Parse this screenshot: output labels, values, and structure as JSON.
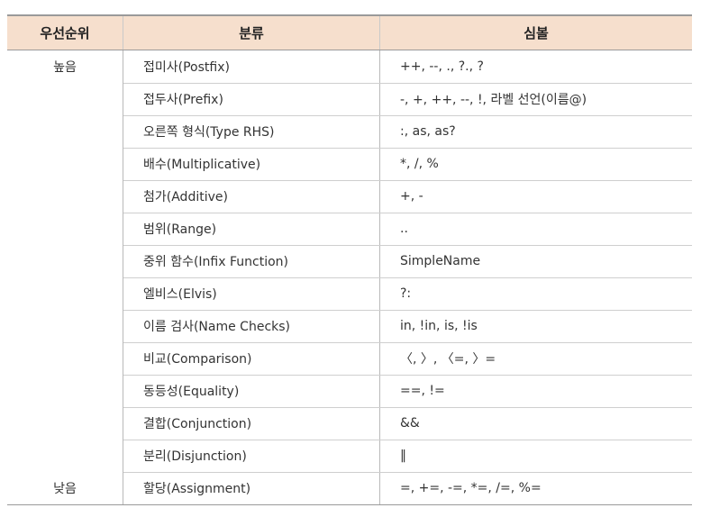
{
  "headers": {
    "priority": "우선순위",
    "category": "분류",
    "symbol": "심볼"
  },
  "rows": [
    {
      "priority": "높음",
      "category": "접미사(Postfix)",
      "symbol": "++, --, ., ?., ?"
    },
    {
      "priority": "",
      "category": "접두사(Prefix)",
      "symbol": "-, +, ++, --, !, 라벨 선언(이름@)"
    },
    {
      "priority": "",
      "category": "오른쪽 형식(Type RHS)",
      "symbol": ":, as, as?"
    },
    {
      "priority": "",
      "category": "배수(Multiplicative)",
      "symbol": "*, /, %"
    },
    {
      "priority": "",
      "category": "첨가(Additive)",
      "symbol": "+, -"
    },
    {
      "priority": "",
      "category": "범위(Range)",
      "symbol": ".."
    },
    {
      "priority": "",
      "category": "중위 함수(Infix Function)",
      "symbol": "SimpleName"
    },
    {
      "priority": "",
      "category": "엘비스(Elvis)",
      "symbol": "?:"
    },
    {
      "priority": "",
      "category": "이름 검사(Name Checks)",
      "symbol": "in, !in, is, !is"
    },
    {
      "priority": "",
      "category": "비교(Comparison)",
      "symbol": "〈, 〉, 〈=, 〉="
    },
    {
      "priority": "",
      "category": "동등성(Equality)",
      "symbol": "==, !="
    },
    {
      "priority": "",
      "category": "결합(Conjunction)",
      "symbol": "&&"
    },
    {
      "priority": "",
      "category": "분리(Disjunction)",
      "symbol": "‖"
    },
    {
      "priority": "낮음",
      "category": "할당(Assignment)",
      "symbol": "=, +=, -=, *=, /=, %="
    }
  ]
}
